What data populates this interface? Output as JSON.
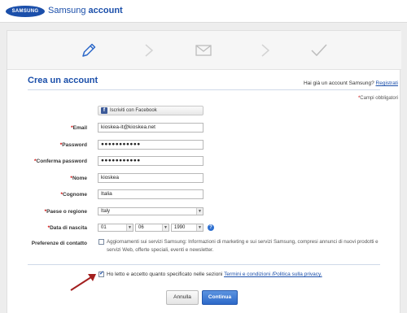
{
  "header": {
    "logo": "SAMSUNG",
    "title_regular": "Samsung",
    "title_bold": "account"
  },
  "steps": {
    "icons": [
      "pencil-icon",
      "envelope-icon",
      "checkmark-icon"
    ],
    "active": "pencil-icon"
  },
  "page": {
    "title": "Crea un account",
    "have_account": "Hai già un account Samsung?",
    "login_link": "Registrati",
    "required_note": "Campi obbligatori"
  },
  "facebook_button": "Iscriviti con Facebook",
  "form": {
    "email": {
      "label": "Email",
      "value": "kioskea-it@kioskea.net"
    },
    "password": {
      "label": "Password",
      "value": "●●●●●●●●●●●"
    },
    "confirm_password": {
      "label": "Conferma password",
      "value": "●●●●●●●●●●●"
    },
    "first_name": {
      "label": "Nome",
      "value": "kioskea"
    },
    "last_name": {
      "label": "Cognome",
      "value": "Italia"
    },
    "country": {
      "label": "Paese o regione",
      "value": "Italy"
    },
    "birthdate": {
      "label": "Data di nascita",
      "day": "01",
      "month": "06",
      "year": "1990"
    },
    "contact_pref": {
      "label": "Preferenze di contatto",
      "text": "Aggiornamenti sui servizi Samsung: Informazioni di marketing e sui servizi Samsung, compresi annunci di nuovi prodotti e servizi Web, offerte speciali, eventi e newsletter."
    }
  },
  "terms": {
    "text": "Ho letto e accetto quanto specificato nelle sezioni",
    "link": "Termini e condizioni /Politica sulla privacy."
  },
  "buttons": {
    "cancel": "Annulla",
    "continue": "Continua"
  },
  "colors": {
    "brand": "#1b4faa",
    "required": "#cc0000",
    "arrow": "#a31f1f"
  }
}
